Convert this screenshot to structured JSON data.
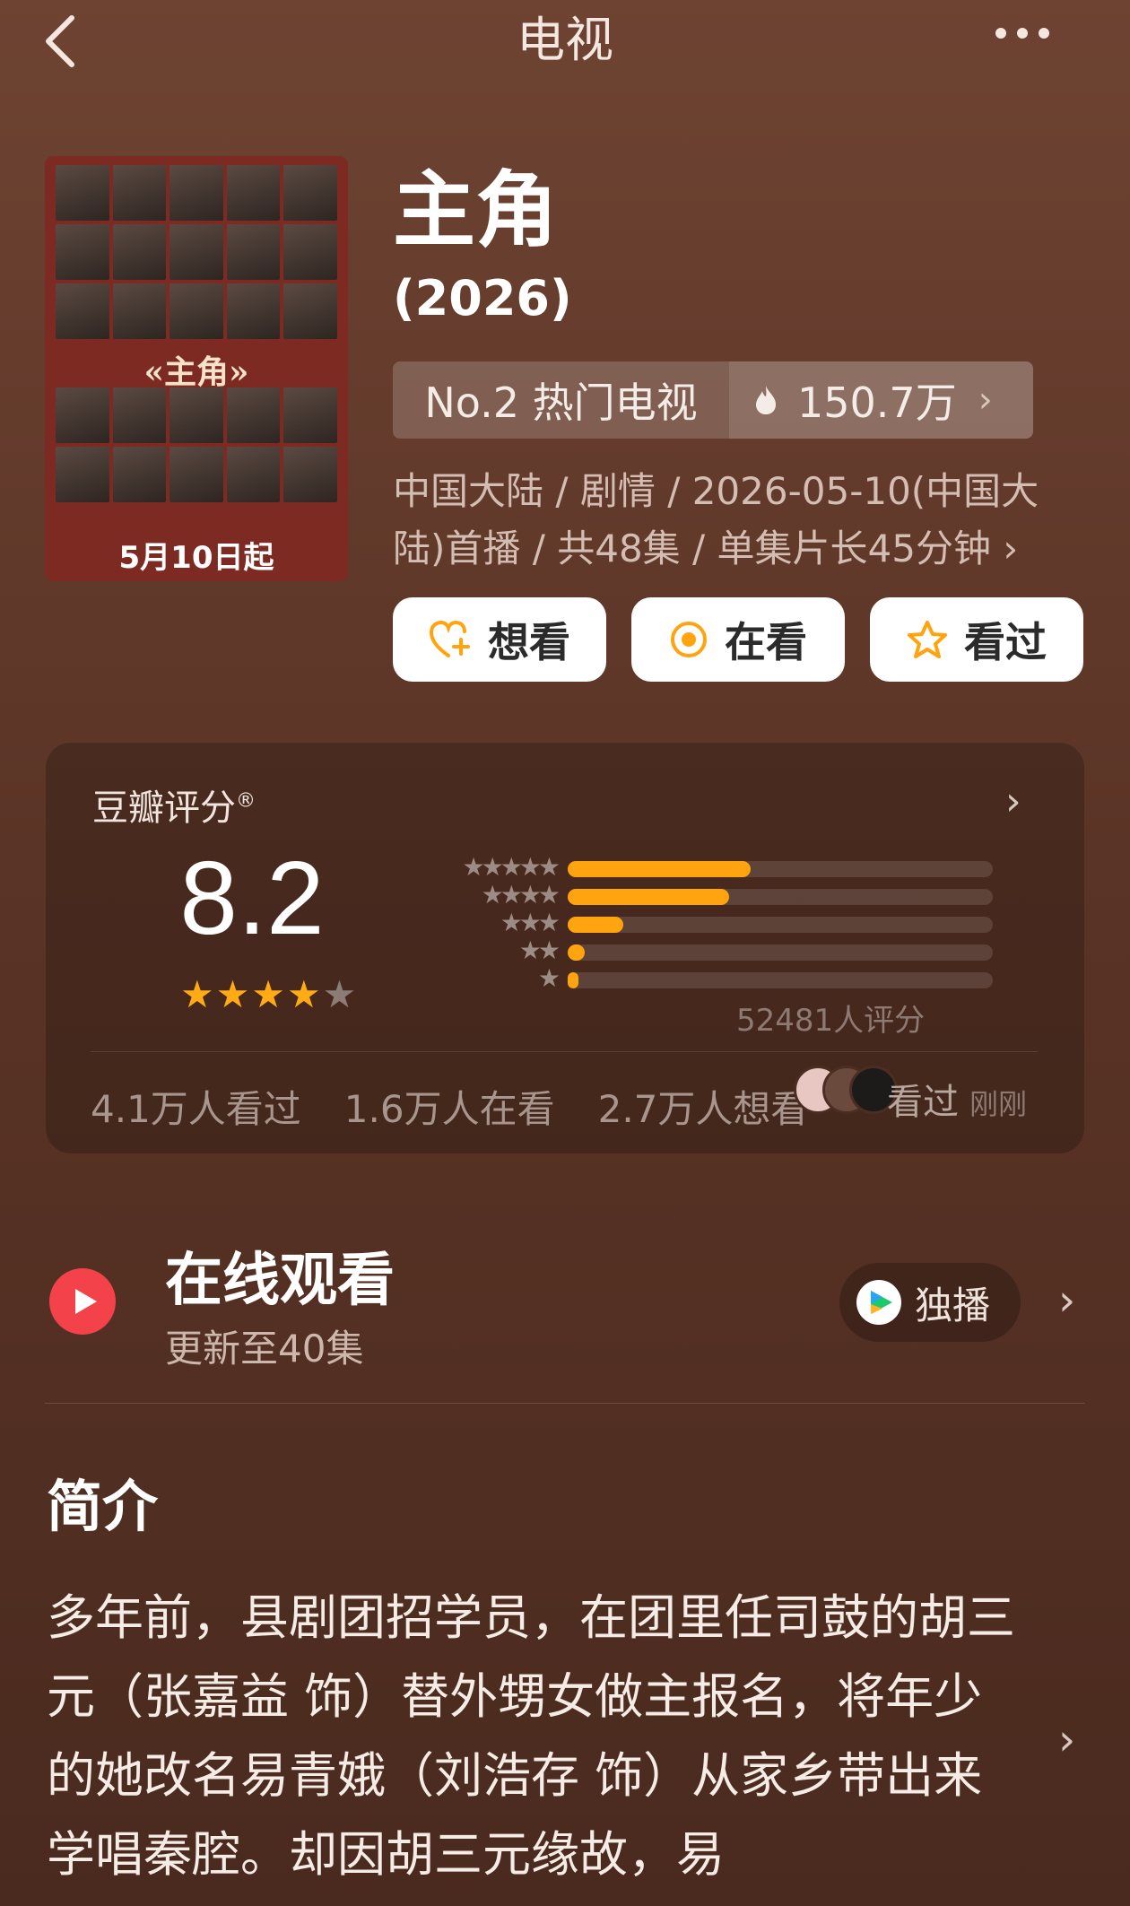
{
  "nav": {
    "title": "电视"
  },
  "poster": {
    "logo_text": "«主角»",
    "date_text": "5月10日起"
  },
  "show": {
    "title": "主角",
    "year": "(2026)"
  },
  "rank": {
    "label": "No.2 热门电视",
    "heat": "150.7万"
  },
  "meta": {
    "text": "中国大陆 / 剧情 / 2026-05-10(中国大陆)首播 / 共48集 / 单集片长45分钟 ›"
  },
  "actions": {
    "want": "想看",
    "watching": "在看",
    "watched": "看过"
  },
  "rating": {
    "title": "豆瓣评分",
    "registered": "®",
    "score": "8.2",
    "star_level": 4,
    "distribution": [
      {
        "stars": 5,
        "fraction": 0.43
      },
      {
        "stars": 4,
        "fraction": 0.38
      },
      {
        "stars": 3,
        "fraction": 0.13
      },
      {
        "stars": 2,
        "fraction": 0.04
      },
      {
        "stars": 1,
        "fraction": 0.02
      }
    ],
    "count": "52481人评分",
    "watched_count": "4.1万人看过",
    "watching_count": "1.6万人在看",
    "want_count": "2.7万人想看",
    "friend_action": "看过",
    "friend_time": "刚刚"
  },
  "watch": {
    "title": "在线观看",
    "subtitle": "更新至40集",
    "platform_label": "独播"
  },
  "synopsis": {
    "title": "简介",
    "text": "多年前，县剧团招学员，在团里任司鼓的胡三元（张嘉益 饰）替外甥女做主报名，将年少的她改名易青娥（刘浩存 饰）从家乡带出来学唱秦腔。却因胡三元缘故，易"
  },
  "colors": {
    "accent": "#ffa30e",
    "background": "#5a3426"
  }
}
